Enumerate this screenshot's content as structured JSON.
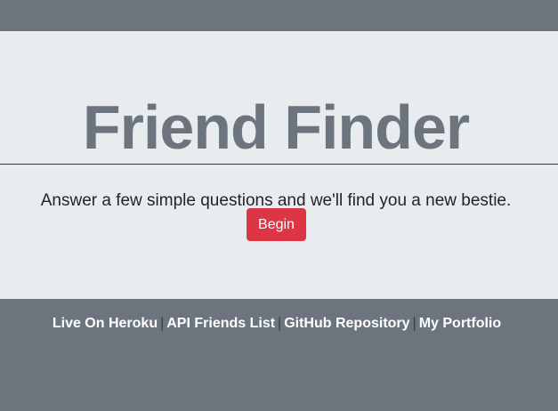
{
  "hero": {
    "title": "Friend Finder",
    "subtitle": "Answer a few simple questions and we'll find you a new bestie.",
    "begin_label": "Begin"
  },
  "footer": {
    "links": [
      {
        "label": "Live On Heroku"
      },
      {
        "label": "API Friends List"
      },
      {
        "label": "GitHub Repository"
      },
      {
        "label": "My Portfolio"
      }
    ],
    "separator": "|"
  },
  "colors": {
    "background_gray": "#6c757d",
    "jumbotron": "#e9ecef",
    "button_red": "#dc3545"
  }
}
